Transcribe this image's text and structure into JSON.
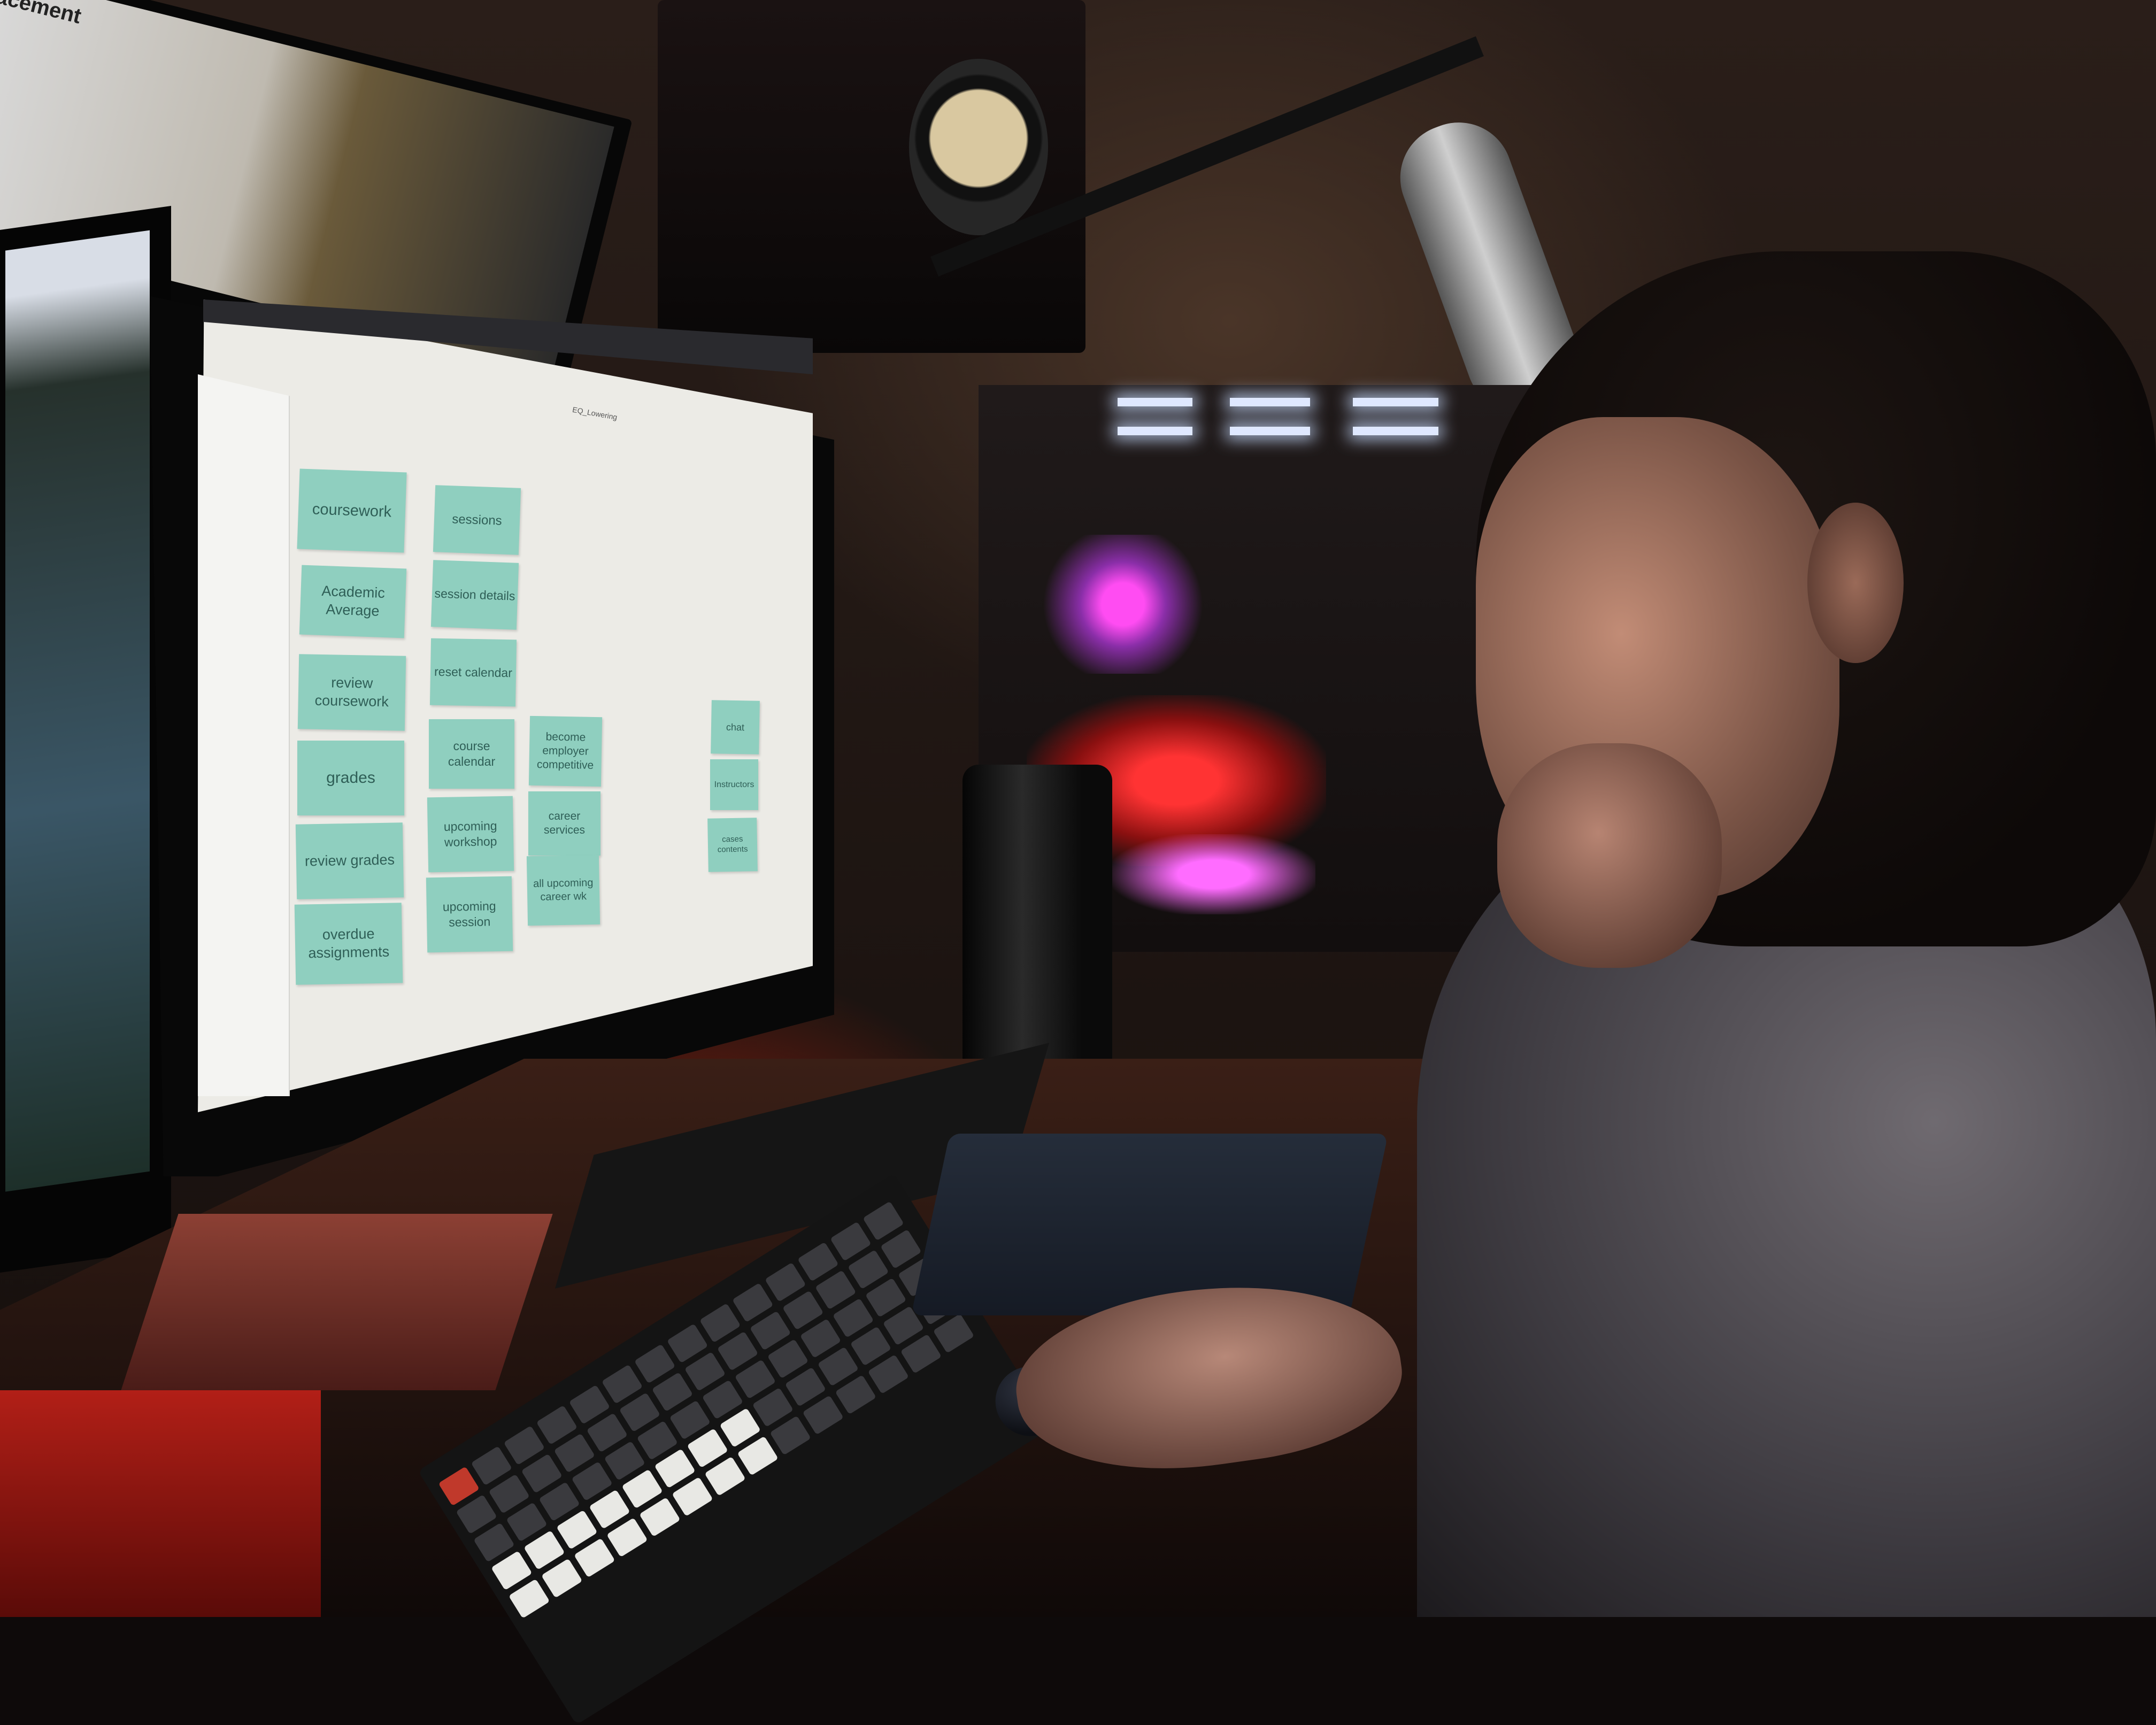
{
  "scene": {
    "colors": {
      "card": "#8fcfbf",
      "card_text": "#2f5f57",
      "backlight": "#ff2a10",
      "case_glow": "#ff4cf2"
    }
  },
  "top_monitor": {
    "title": "acement"
  },
  "main_monitor": {
    "doc_title": "EQ_Lowering"
  },
  "board": {
    "cards": [
      {
        "label": "coursework"
      },
      {
        "label": "Academic Average"
      },
      {
        "label": "review coursework"
      },
      {
        "label": "grades"
      },
      {
        "label": "review grades"
      },
      {
        "label": "overdue assignments"
      },
      {
        "label": "sessions"
      },
      {
        "label": "session details"
      },
      {
        "label": "reset calendar"
      },
      {
        "label": "course calendar"
      },
      {
        "label": "upcoming workshop"
      },
      {
        "label": "upcoming session"
      },
      {
        "label": "become employer competitive"
      },
      {
        "label": "career services"
      },
      {
        "label": "all upcoming career wk"
      },
      {
        "label": "chat"
      },
      {
        "label": "Instructors"
      },
      {
        "label": "cases contents"
      }
    ]
  }
}
